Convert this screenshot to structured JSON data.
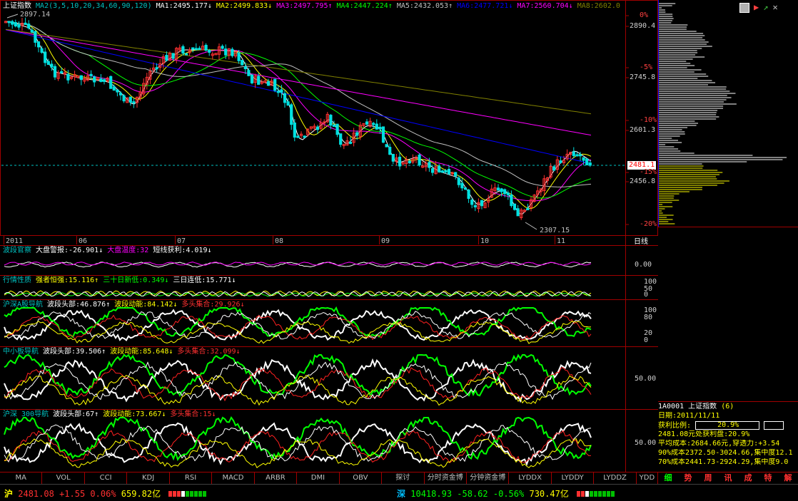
{
  "main": {
    "index_name": "上证指数",
    "ma_params": "MA2(3,5,10,20,34,60,90,120)",
    "ma": [
      {
        "label": "MA1:2495.177↓",
        "color": "#ffffff"
      },
      {
        "label": "MA2:2499.833↓",
        "color": "#ffff00"
      },
      {
        "label": "MA3:2497.795↑",
        "color": "#ff00ff"
      },
      {
        "label": "MA4:2447.224↑",
        "color": "#00ff00"
      },
      {
        "label": "MA5:2432.053↑",
        "color": "#c0c0c0"
      },
      {
        "label": "MA6:2477.721↓",
        "color": "#0000ff"
      },
      {
        "label": "MA7:2560.704↓",
        "color": "#ff00ff"
      },
      {
        "label": "MA8:2602.0",
        "color": "#808000"
      }
    ],
    "high_marker": "2897.14",
    "low_marker": "2307.15",
    "price_tag": "2481.1",
    "right_axis": [
      "0%",
      "2890.4",
      "-5%",
      "2745.8",
      "-10%",
      "2601.3",
      "-15%",
      "2456.8",
      "-20%"
    ],
    "months": [
      "2011",
      "06",
      "07",
      "08",
      "09",
      "10",
      "11"
    ],
    "period": "日线"
  },
  "indicators": [
    {
      "name": "波段官察",
      "items": [
        {
          "t": "大盘警报:-26.901↓",
          "c": "#ffffff"
        },
        {
          "t": "大盘温度:32",
          "c": "#ff00ff"
        },
        {
          "t": "短线获利:4.019↓",
          "c": "#ffffff"
        }
      ],
      "axis": [
        "0.00"
      ]
    },
    {
      "name": "行情性质",
      "items": [
        {
          "t": "强者恒强:15.116↑",
          "c": "#ffff00"
        },
        {
          "t": "三十日新低:0.349↓",
          "c": "#00ff00"
        },
        {
          "t": "三日连低:15.771↓",
          "c": "#ffffff"
        }
      ],
      "axis": [
        "100",
        "50",
        "0"
      ]
    },
    {
      "name": "沪深A股导航",
      "items": [
        {
          "t": "波段头部:46.876↑",
          "c": "#ffffff"
        },
        {
          "t": "波段动能:84.142↓",
          "c": "#ffff00"
        },
        {
          "t": "多头集合:29.926↓",
          "c": "#ff3030"
        }
      ],
      "axis": [
        "100",
        "80",
        "20",
        "0"
      ]
    },
    {
      "name": "中小板导航",
      "items": [
        {
          "t": "波段头部:39.506↑",
          "c": "#ffffff"
        },
        {
          "t": "波段动能:85.648↓",
          "c": "#ffff00"
        },
        {
          "t": "多头集合:32.099↓",
          "c": "#ff3030"
        }
      ],
      "axis": [
        "50.00"
      ]
    },
    {
      "name": "沪深 300导航",
      "items": [
        {
          "t": "波段头部:67↑",
          "c": "#ffffff"
        },
        {
          "t": "波段动能:73.667↓",
          "c": "#ffff00"
        },
        {
          "t": "多头集合:15↓",
          "c": "#ff3030"
        }
      ],
      "axis": [
        "50.00"
      ]
    }
  ],
  "tabs": [
    "MA",
    "VOL",
    "CCI",
    "KDJ",
    "RSI",
    "MACD",
    "ARBR",
    "DMI",
    "OBV",
    "探讨",
    "分时资金博",
    "分钟资金博",
    "LYDDX",
    "LYDDY",
    "LYDDZ",
    "YDD"
  ],
  "right_tabs": [
    "细",
    "势",
    "周",
    "讯",
    "成",
    "特",
    "解"
  ],
  "info": {
    "code": "1A0001",
    "name": "上证指数",
    "suffix": "(6)",
    "date": "日期:2011/11/11",
    "profit_label": "获利比例:",
    "profit_value": "20.9%",
    "line1": "2481.08元处获利盘:20.9%",
    "line2": "平均成本:2684.66元,穿透力:+3.54",
    "line3": "90%成本2372.50-3024.66,集中度12.1",
    "line4": "70%成本2441.73-2924.29,集中度9.0"
  },
  "status": {
    "sh_label": "沪",
    "sh_price": "2481.08",
    "sh_change": "+1.55",
    "sh_pct": "0.06%",
    "sh_amount": "659.82亿",
    "sz_label": "深",
    "sz_price": "10418.93",
    "sz_change": "-58.62",
    "sz_pct": "-0.56%",
    "sz_amount": "730.47亿"
  }
}
